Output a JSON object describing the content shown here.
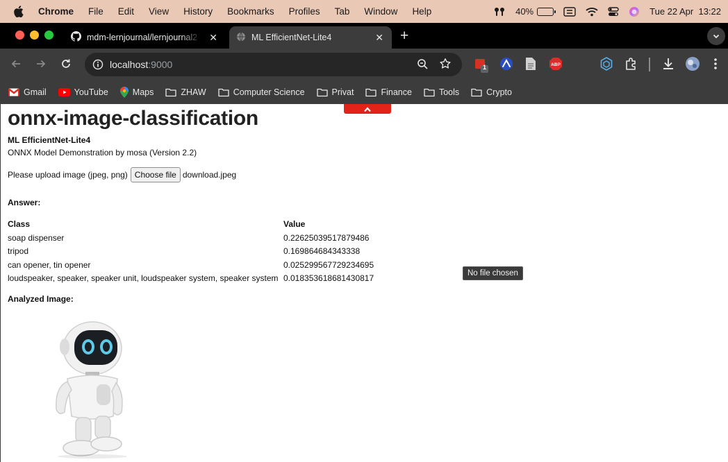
{
  "menubar": {
    "app": "Chrome",
    "items": [
      "File",
      "Edit",
      "View",
      "History",
      "Bookmarks",
      "Profiles",
      "Tab",
      "Window",
      "Help"
    ],
    "battery_percent": "40%",
    "battery_level": 0.4,
    "datetime": "Tue 22 Apr  13:22"
  },
  "tabs": [
    {
      "title": "mdm-lernjournal/lernjournal2",
      "icon": "github-icon",
      "active": false
    },
    {
      "title": "ML EfficientNet-Lite4",
      "icon": "globe-icon",
      "active": true
    }
  ],
  "toolbar": {
    "url_host": "localhost",
    "url_port": ":9000",
    "extension_badge": "1",
    "abp_label": "ABP"
  },
  "bookmarks": [
    {
      "label": "Gmail",
      "icon": "gmail-icon"
    },
    {
      "label": "YouTube",
      "icon": "youtube-icon"
    },
    {
      "label": "Maps",
      "icon": "maps-icon"
    },
    {
      "label": "ZHAW",
      "icon": "folder-icon"
    },
    {
      "label": "Computer Science",
      "icon": "folder-icon"
    },
    {
      "label": "Privat",
      "icon": "folder-icon"
    },
    {
      "label": "Finance",
      "icon": "folder-icon"
    },
    {
      "label": "Tools",
      "icon": "folder-icon"
    },
    {
      "label": "Crypto",
      "icon": "folder-icon"
    }
  ],
  "page": {
    "title": "onnx-image-classification",
    "subtitle": "ML EfficientNet-Lite4",
    "description": "ONNX Model Demonstration by mosa (Version 2.2)",
    "upload_prompt": "Please upload image (jpeg, png)",
    "choose_file_label": "Choose file",
    "file_name": "download.jpeg",
    "answer_label": "Answer:",
    "table": {
      "headers": [
        "Class",
        "Value"
      ],
      "rows": [
        [
          "soap dispenser",
          "0.22625039517879486"
        ],
        [
          "tripod",
          "0.169864684343338"
        ],
        [
          "can opener, tin opener",
          "0.025299567729234695"
        ],
        [
          "loudspeaker, speaker, speaker unit, loudspeaker system, speaker system",
          "0.018353618681430817"
        ]
      ]
    },
    "tooltip": "No file chosen",
    "analyzed_label": "Analyzed Image:"
  }
}
